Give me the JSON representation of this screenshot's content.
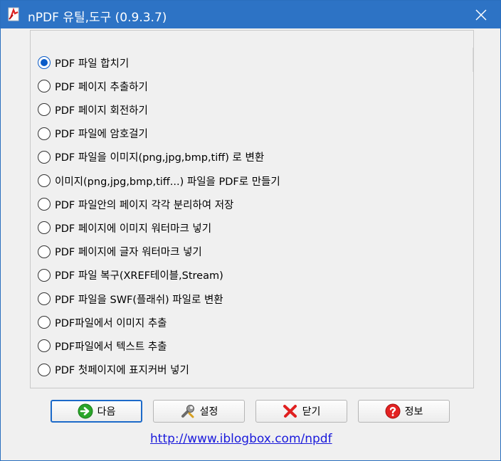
{
  "window": {
    "title": "nPDF 유틸,도구 (0.9.3.7)",
    "close_glyph": "✕"
  },
  "options": [
    {
      "label": "PDF 파일 합치기",
      "checked": true
    },
    {
      "label": "PDF 페이지 추출하기",
      "checked": false
    },
    {
      "label": "PDF 페이지 회전하기",
      "checked": false
    },
    {
      "label": "PDF 파일에 암호걸기",
      "checked": false
    },
    {
      "label": "PDF 파일을 이미지(png,jpg,bmp,tiff) 로 변환",
      "checked": false
    },
    {
      "label": "이미지(png,jpg,bmp,tiff...) 파일을 PDF로 만들기",
      "checked": false
    },
    {
      "label": "PDF 파일안의 페이지 각각 분리하여 저장",
      "checked": false
    },
    {
      "label": "PDF 페이지에 이미지 워터마크 넣기",
      "checked": false
    },
    {
      "label": "PDF 페이지에 글자 워터마크 넣기",
      "checked": false
    },
    {
      "label": "PDF 파일 복구(XREF테이블,Stream)",
      "checked": false
    },
    {
      "label": "PDF 파일을 SWF(플래쉬) 파일로 변환",
      "checked": false
    },
    {
      "label": "PDF파일에서 이미지 추출",
      "checked": false
    },
    {
      "label": "PDF파일에서 텍스트 추출",
      "checked": false
    },
    {
      "label": "PDF 첫페이지에 표지커버 넣기",
      "checked": false
    }
  ],
  "buttons": {
    "next": "다음",
    "settings": "설정",
    "close": "닫기",
    "info": "정보"
  },
  "footer": {
    "link_text": "http://www.iblogbox.com/npdf"
  },
  "colors": {
    "titlebar": "#2d73c5",
    "accent": "#0a5bc8",
    "link": "#1a1adb"
  }
}
